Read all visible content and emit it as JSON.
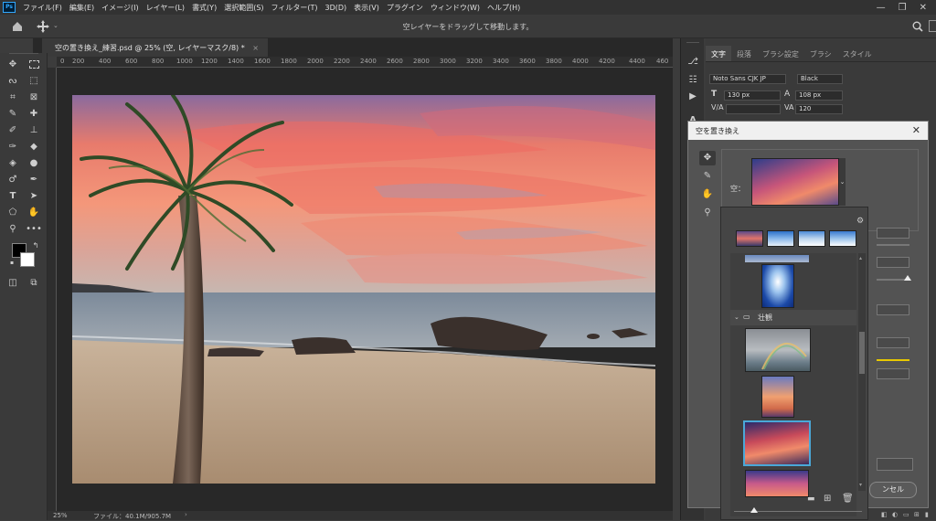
{
  "menu": {
    "logo": "Ps",
    "items": [
      "ファイル(F)",
      "編集(E)",
      "イメージ(I)",
      "レイヤー(L)",
      "書式(Y)",
      "選択範囲(S)",
      "フィルター(T)",
      "3D(D)",
      "表示(V)",
      "プラグイン",
      "ウィンドウ(W)",
      "ヘルプ(H)"
    ]
  },
  "options": {
    "hint": "空レイヤーをドラッグして移動します。"
  },
  "document": {
    "tab_title": "空の置き換え_練習.psd @ 25% (空, レイヤーマスク/8) *",
    "close": "×"
  },
  "ruler": {
    "ticks": [
      "0",
      "200",
      "400",
      "600",
      "800",
      "1000",
      "1200",
      "1400",
      "1600",
      "1800",
      "2000",
      "2200",
      "2400",
      "2600",
      "2800",
      "3000",
      "3200",
      "3400",
      "3600",
      "3800",
      "4000",
      "4200",
      "4400",
      "460"
    ]
  },
  "status": {
    "zoom": "25%",
    "file_info": "ファイル：40.1M/905.7M"
  },
  "character_panel": {
    "tabs": [
      "文字",
      "段落",
      "ブラシ設定",
      "ブラシ",
      "スタイル"
    ],
    "font_family": "Noto Sans CJK JP",
    "font_style": "Black",
    "font_size": "130 px",
    "leading": "108 px",
    "tracking": "120"
  },
  "sky_dialog": {
    "title": "空を置き換え",
    "sky_label": "空：",
    "cancel_label": "ンセル",
    "folder_label": "壮観"
  },
  "colors": {
    "accent": "#31a8ff",
    "selected_thumb_border": "#4aa8d8",
    "slider_yellow": "#e8c800"
  }
}
